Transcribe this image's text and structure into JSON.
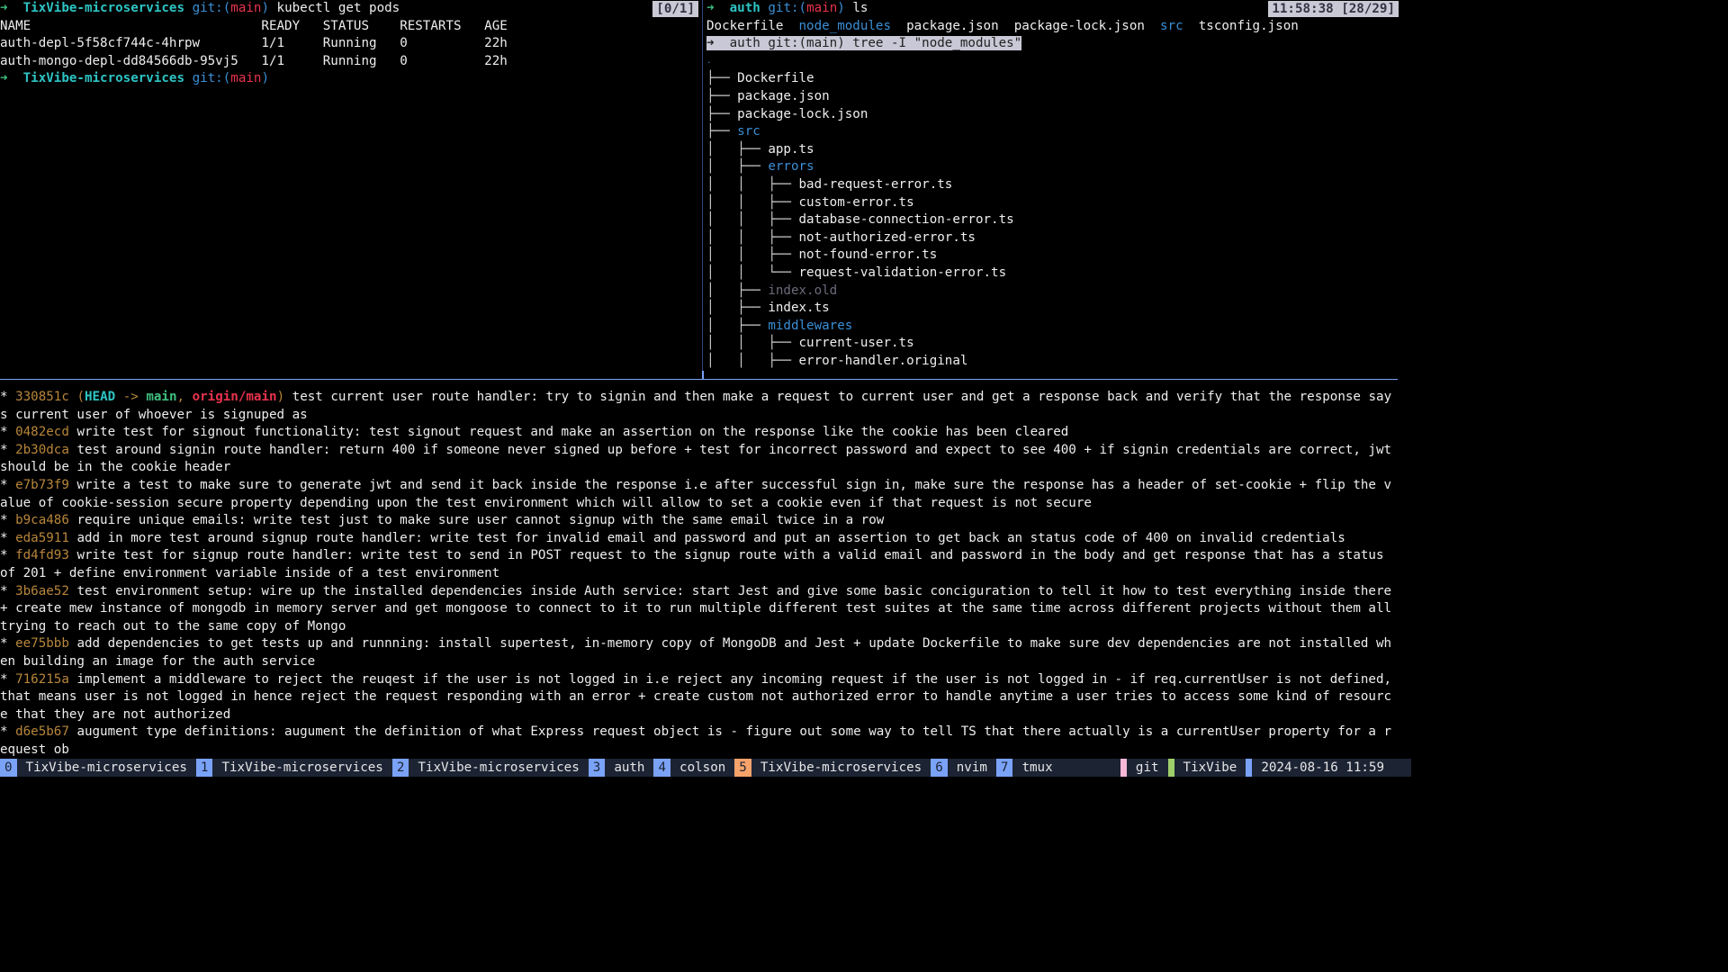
{
  "left_pane": {
    "prompt": {
      "arrow": "➜",
      "dir": "TixVibe-microservices",
      "git": "git:(",
      "branch": "main",
      ")": ")",
      "command": "kubectl get pods"
    },
    "badge": "[0/1]",
    "table_headers": [
      "NAME",
      "READY",
      "STATUS",
      "RESTARTS",
      "AGE"
    ],
    "rows": [
      [
        "auth-depl-5f58cf744c-4hrpw",
        "1/1",
        "Running",
        "0",
        "22h"
      ],
      [
        "auth-mongo-depl-dd84566db-95vj5",
        "1/1",
        "Running",
        "0",
        "22h"
      ]
    ],
    "prompt2": {
      "arrow": "➜",
      "dir": "TixVibe-microservices",
      "git": "git:(",
      "branch": "main",
      "close": ")"
    }
  },
  "right_pane": {
    "prompt": {
      "arrow": "➜",
      "dir": "auth",
      "git": "git:(",
      "branch": "main",
      "close": ")",
      "command": "ls"
    },
    "badge": "11:58:38 [28/29]",
    "ls": [
      "Dockerfile",
      "node_modules",
      "package.json",
      "package-lock.json",
      "src",
      "tsconfig.json"
    ],
    "tree_cmd": "➜  auth git:(main) tree -I \"node_modules\"",
    "tree_root": ".",
    "tree": [
      {
        "prefix": "├── ",
        "name": "Dockerfile",
        "kind": "file"
      },
      {
        "prefix": "├── ",
        "name": "package.json",
        "kind": "file"
      },
      {
        "prefix": "├── ",
        "name": "package-lock.json",
        "kind": "file"
      },
      {
        "prefix": "├── ",
        "name": "src",
        "kind": "dir"
      },
      {
        "prefix": "│   ├── ",
        "name": "app.ts",
        "kind": "file"
      },
      {
        "prefix": "│   ├── ",
        "name": "errors",
        "kind": "dir"
      },
      {
        "prefix": "│   │   ├── ",
        "name": "bad-request-error.ts",
        "kind": "file"
      },
      {
        "prefix": "│   │   ├── ",
        "name": "custom-error.ts",
        "kind": "file"
      },
      {
        "prefix": "│   │   ├── ",
        "name": "database-connection-error.ts",
        "kind": "file"
      },
      {
        "prefix": "│   │   ├── ",
        "name": "not-authorized-error.ts",
        "kind": "file"
      },
      {
        "prefix": "│   │   ├── ",
        "name": "not-found-error.ts",
        "kind": "file"
      },
      {
        "prefix": "│   │   └── ",
        "name": "request-validation-error.ts",
        "kind": "file"
      },
      {
        "prefix": "│   ├── ",
        "name": "index.old",
        "kind": "dim"
      },
      {
        "prefix": "│   ├── ",
        "name": "index.ts",
        "kind": "file"
      },
      {
        "prefix": "│   ├── ",
        "name": "middlewares",
        "kind": "dir"
      },
      {
        "prefix": "│   │   ├── ",
        "name": "current-user.ts",
        "kind": "file"
      },
      {
        "prefix": "│   │   ├── ",
        "name": "error-handler.original",
        "kind": "file"
      }
    ]
  },
  "git_log": {
    "head_ref": {
      "open": "(",
      "head": "HEAD",
      "arrow": " -> ",
      "main": "main",
      "comma": ", ",
      "origin": "origin/main",
      "close": ")"
    },
    "commits": [
      {
        "hash": "330851c",
        "msg": "test current user route handler: try to signin and then make a request to current user and get a response back and verify that the response says current user of whoever is signuped as",
        "head": true
      },
      {
        "hash": "0482ecd",
        "msg": "write test for signout functionality: test signout request and make an assertion on the response like the cookie has been cleared"
      },
      {
        "hash": "2b30dca",
        "msg": "test around signin route handler: return 400 if someone never signed up before + test for incorrect password and expect to see 400 + if signin credentials are correct, jwt should be in the cookie header"
      },
      {
        "hash": "e7b73f9",
        "msg": "write a test to make sure to generate jwt and send it back inside the response i.e after successful sign in, make sure the response has a header of set-cookie + flip the value of cookie-session secure property depending upon the test environment which will allow to set a cookie even if that request is not secure"
      },
      {
        "hash": "b9ca486",
        "msg": "require unique emails: write test just to make sure user cannot signup with the same email twice in a row"
      },
      {
        "hash": "eda5911",
        "msg": "add in more test around signup route handler: write test for invalid email and password and put an assertion to get back an status code of 400 on invalid credentials"
      },
      {
        "hash": "fd4fd93",
        "msg": "write test for signup route handler: write test to send in POST request to the signup route with a valid email and password in the body and get response that has a status of 201 + define environment variable inside of a test environment"
      },
      {
        "hash": "3b6ae52",
        "msg": "test environment setup: wire up the installed dependencies inside Auth service: start Jest and give some basic conciguration to tell it how to test everything inside there + create mew instance of mongodb in memory server and get mongoose to connect to it to run multiple different test suites at the same time across different projects without them all trying to reach out to the same copy of Mongo"
      },
      {
        "hash": "ee75bbb",
        "msg": "add dependencies to get tests up and runnning: install supertest, in-memory copy of MongoDB and Jest + update Dockerfile to make sure dev dependencies are not installed when building an image for the auth service"
      },
      {
        "hash": "716215a",
        "msg": "implement a middleware to reject the reuqest if the user is not logged in i.e reject any incoming request if the user is not logged in - if req.currentUser is not defined, that means user is not logged in hence reject the request responding with an error + create custom not authorized error to handle anytime a user tries to access some kind of resource that they are not authorized"
      },
      {
        "hash": "d6e5b67",
        "msg": "augument type definitions: augument the definition of what Express request object is - figure out some way to tell TS that there actually is a currentUser property for a request ob"
      }
    ],
    "pager_prompt": ":"
  },
  "statusbar": {
    "windows": [
      {
        "idx": "0",
        "name": "TixVibe-microservices"
      },
      {
        "idx": "1",
        "name": "TixVibe-microservices"
      },
      {
        "idx": "2",
        "name": "TixVibe-microservices"
      },
      {
        "idx": "3",
        "name": "auth"
      },
      {
        "idx": "4",
        "name": "colson"
      },
      {
        "idx": "5",
        "name": "TixVibe-microservices",
        "active": true
      },
      {
        "idx": "6",
        "name": "nvim"
      },
      {
        "idx": "7",
        "name": "tmux"
      }
    ],
    "right": [
      {
        "label": "git",
        "color": "#f7b7d7"
      },
      {
        "label": "TixVibe",
        "color": "#9ece6a"
      },
      {
        "label": "2024-08-16 11:59",
        "color": "#7aa2f7"
      }
    ]
  },
  "colors": {
    "background": "#000000",
    "accent": "#7aa2f7",
    "active_window": "#f6a26b",
    "statusbar": "#1c2333"
  }
}
